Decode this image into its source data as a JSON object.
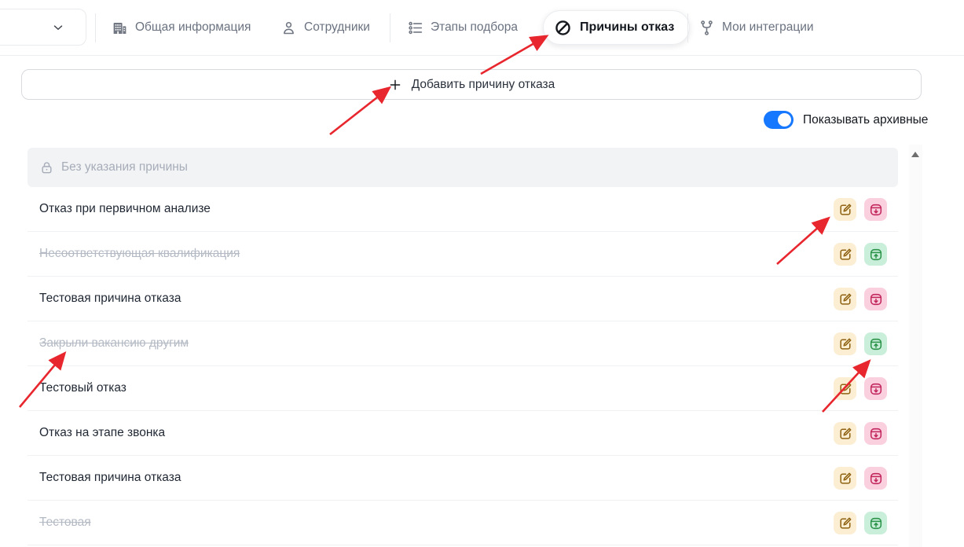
{
  "header": {
    "tabs": [
      {
        "label": "Общая информация",
        "icon": "building-icon",
        "active": false
      },
      {
        "label": "Сотрудники",
        "icon": "person-icon",
        "active": false
      },
      {
        "label": "Этапы подбора",
        "icon": "list-icon",
        "active": false
      },
      {
        "label": "Причины отказ",
        "icon": "block-icon",
        "active": true
      },
      {
        "label": "Мои интеграции",
        "icon": "branch-icon",
        "active": false
      }
    ]
  },
  "toolbar": {
    "add_button_label": "Добавить причину отказа",
    "add_button_icon": "plus-icon",
    "toggle_label": "Показывать архивные",
    "toggle_on": true
  },
  "list": {
    "locked_row": {
      "label": "Без указания причины",
      "icon": "lock-icon"
    },
    "rows": [
      {
        "label": "Отказ при первичном анализе",
        "archived": false
      },
      {
        "label": "Несоответствующая квалификация",
        "archived": true
      },
      {
        "label": "Тестовая причина отказа",
        "archived": false
      },
      {
        "label": "Закрыли вакансию другим",
        "archived": true
      },
      {
        "label": "Тестовый отказ",
        "archived": false
      },
      {
        "label": "Отказ на этапе звонка",
        "archived": false
      },
      {
        "label": "Тестовая причина отказа",
        "archived": false
      },
      {
        "label": "Тестовая",
        "archived": true
      }
    ],
    "row_actions": {
      "edit_icon": "edit-icon",
      "archive_icon": "archive-down-icon",
      "unarchive_icon": "unarchive-up-icon"
    }
  },
  "colors": {
    "accent_blue": "#1677ff",
    "annotation_arrow": "#e8262d",
    "edit_bg": "#fbeed3",
    "edit_icon": "#8f6313",
    "archive_bg": "#fad0de",
    "archive_icon": "#c2255c",
    "unarchive_bg": "#c9eeda",
    "unarchive_icon": "#2b9348",
    "locked_row_bg": "#f2f3f5",
    "archived_text": "#b4bac4"
  }
}
